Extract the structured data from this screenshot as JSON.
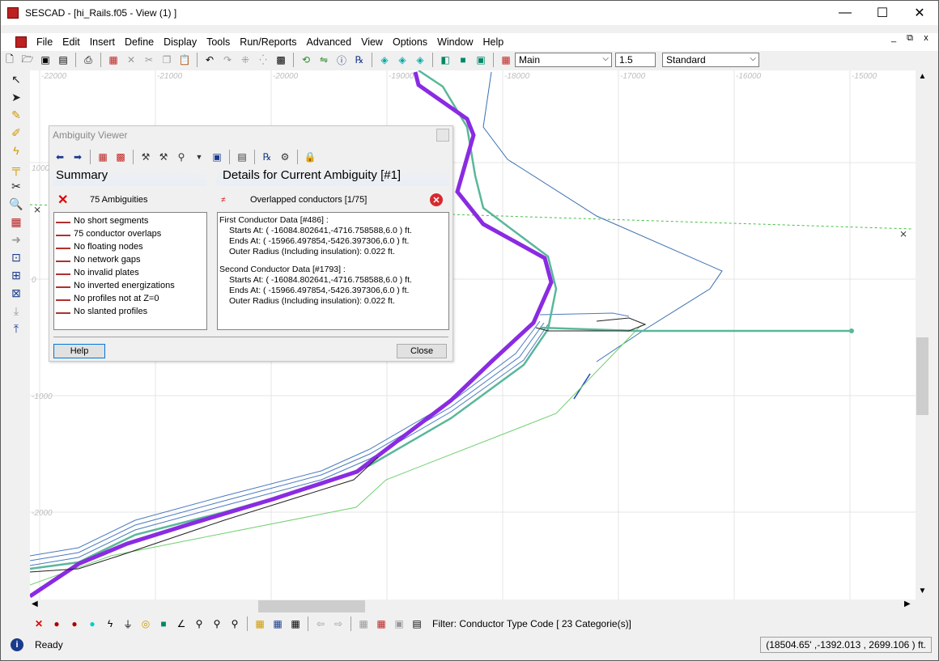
{
  "window": {
    "title": "SESCAD - [hi_Rails.f05 - View (1) ]",
    "minimize_glyph": "—",
    "maximize_glyph": "☐",
    "close_glyph": "✕"
  },
  "menubar": {
    "items": [
      "File",
      "Edit",
      "Insert",
      "Define",
      "Display",
      "Tools",
      "Run/Reports",
      "Advanced",
      "View",
      "Options",
      "Window",
      "Help"
    ],
    "mdi_buttons": [
      "_",
      "⧉",
      "x"
    ]
  },
  "toolbar": {
    "layer_select": "Main",
    "value_field": "1.5",
    "style_select": "Standard"
  },
  "axis": {
    "x_ticks": [
      "-22000",
      "-21000",
      "-20000",
      "-19000",
      "-18000",
      "-17000",
      "-16000",
      "-15000"
    ],
    "y_ticks": [
      "1000",
      "0",
      "-1000",
      "-2000"
    ]
  },
  "dialog": {
    "title": "Ambiguity Viewer",
    "summary_header": "Summary",
    "details_header": "Details for Current Ambiguity [#1]",
    "summary_count": "75 Ambiguities",
    "details_label": "Overlapped conductors [1/75]",
    "summary_items": [
      "No short segments",
      "75 conductor overlaps",
      "No floating nodes",
      "No network gaps",
      "No invalid plates",
      "No inverted energizations",
      "No profiles not at Z=0",
      "No slanted profiles"
    ],
    "details": {
      "first_title": "First Conductor Data [#486] :",
      "first_starts": "Starts At: ( -16084.802641,-4716.758588,6.0 ) ft.",
      "first_ends": "Ends At: ( -15966.497854,-5426.397306,6.0 ) ft.",
      "first_radius": "Outer Radius (Including insulation): 0.022 ft.",
      "second_title": "Second Conductor Data [#1793] :",
      "second_starts": "Starts At: ( -16084.802641,-4716.758588,6.0 ) ft.",
      "second_ends": "Ends At: ( -15966.497854,-5426.397306,6.0 ) ft.",
      "second_radius": "Outer Radius (Including insulation): 0.022 ft."
    },
    "help_button": "Help",
    "close_button": "Close"
  },
  "bottom_toolbar": {
    "filter_text": "Filter: Conductor Type Code [ 23 Categorie(s)]"
  },
  "status": {
    "ready": "Ready",
    "coords": "(18504.65' ,-1392.013 , 2699.106 ) ft."
  },
  "colors": {
    "purple_conductor": "#8a2be2",
    "blue_conductor": "#3a6fb0",
    "green_conductor": "#5fd35f",
    "teal_conductor": "#5ab79a",
    "grid": "#e4e4e4"
  }
}
